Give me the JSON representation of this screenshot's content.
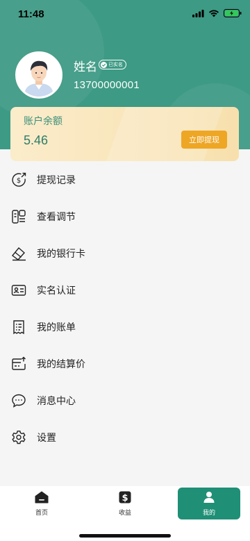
{
  "status_bar": {
    "time": "11:48"
  },
  "profile": {
    "name": "姓名",
    "verified": "已实名",
    "phone": "13700000001"
  },
  "balance": {
    "label": "账户余额",
    "amount": "5.46",
    "withdraw": "立即提现"
  },
  "menu": {
    "items": [
      {
        "label": "提现记录",
        "icon": "withdraw-history-icon"
      },
      {
        "label": "查看调节",
        "icon": "adjustment-icon"
      },
      {
        "label": "我的银行卡",
        "icon": "bank-card-icon"
      },
      {
        "label": "实名认证",
        "icon": "id-card-icon"
      },
      {
        "label": "我的账单",
        "icon": "bill-icon"
      },
      {
        "label": "我的结算价",
        "icon": "settlement-icon"
      },
      {
        "label": "消息中心",
        "icon": "message-icon"
      },
      {
        "label": "设置",
        "icon": "gear-icon"
      }
    ]
  },
  "tabbar": {
    "tabs": [
      {
        "label": "首页",
        "icon": "home-icon"
      },
      {
        "label": "收益",
        "icon": "dollar-icon"
      },
      {
        "label": "我的",
        "icon": "person-icon",
        "active": true
      }
    ]
  },
  "colors": {
    "accent": "#3d9a84",
    "active_tab": "#1f8f76",
    "withdraw_button": "#eea625"
  }
}
